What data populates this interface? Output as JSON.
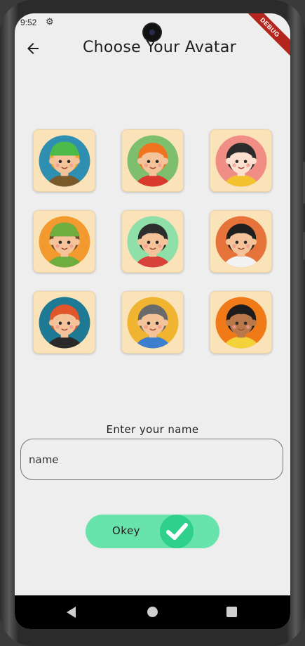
{
  "status_bar": {
    "time": "9:52",
    "settings_icon": "gear-icon"
  },
  "debug_banner": "DEBUG",
  "header": {
    "title": "Choose Your Avatar",
    "back_icon": "arrow-left-icon"
  },
  "avatars": [
    {
      "icon": "avatar-boy-green-cap-icon",
      "bg": "#2f8fb0",
      "skin": "#f4c39a",
      "hair": "#f0a52a",
      "hat": "#4cbb4a",
      "shirt": "#7a5a2a"
    },
    {
      "icon": "avatar-boy-orange-hair-icon",
      "bg": "#7ebf6e",
      "skin": "#f4c39a",
      "hair": "#f0731f",
      "hat": null,
      "shirt": "#d83a2e"
    },
    {
      "icon": "avatar-girl-black-buns-icon",
      "bg": "#f08e85",
      "skin": "#fde0cf",
      "hair": "#2b2b2b",
      "hat": null,
      "shirt": "#f1c22e"
    },
    {
      "icon": "avatar-boy-green-beanie-icon",
      "bg": "#f29a2e",
      "skin": "#f4c39a",
      "hair": "#6d4b2a",
      "hat": "#6fae3e",
      "shirt": "#6fae3e"
    },
    {
      "icon": "avatar-boy-dark-hair-icon",
      "bg": "#8fe0a8",
      "skin": "#f4c39a",
      "hair": "#2d2d2d",
      "hat": null,
      "shirt": "#d8423a"
    },
    {
      "icon": "avatar-girl-black-hair-icon",
      "bg": "#e6743a",
      "skin": "#f4c39a",
      "hair": "#1f1f1f",
      "hat": null,
      "shirt": "#f2f2f2"
    },
    {
      "icon": "avatar-girl-red-hair-icon",
      "bg": "#1e7a94",
      "skin": "#f4c39a",
      "hair": "#e0562a",
      "hat": null,
      "shirt": "#2a2a2a"
    },
    {
      "icon": "avatar-grandma-glasses-icon",
      "bg": "#f1b431",
      "skin": "#f4c39a",
      "hair": "#6a6a6a",
      "hat": null,
      "shirt": "#3a7fd0"
    },
    {
      "icon": "avatar-girl-curly-hair-icon",
      "bg": "#f07a17",
      "skin": "#b9784a",
      "hair": "#1c1c1c",
      "hat": null,
      "shirt": "#f4d23a"
    }
  ],
  "form": {
    "label": "Enter your name",
    "placeholder": "name",
    "value": ""
  },
  "okey_button": {
    "label": "Okey",
    "icon": "checkmark-icon"
  },
  "nav": {
    "back_icon": "nav-back-icon",
    "home_icon": "nav-home-icon",
    "recents_icon": "nav-recents-icon"
  }
}
